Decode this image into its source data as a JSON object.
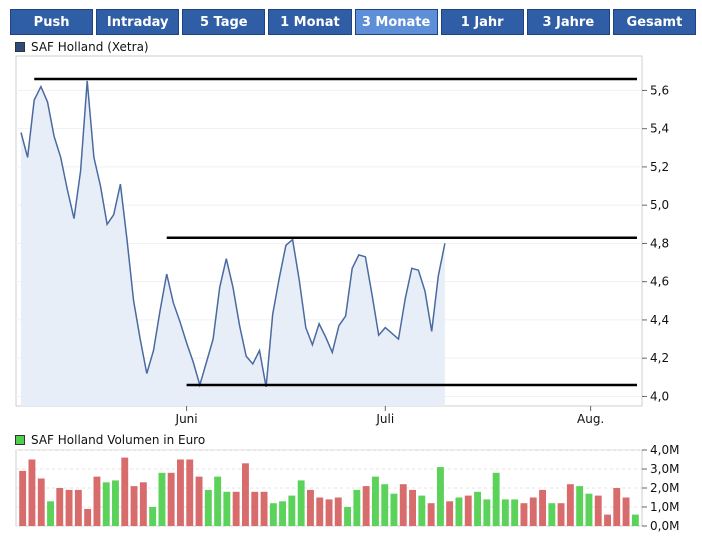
{
  "tabs": [
    {
      "label": "Push",
      "active": false
    },
    {
      "label": "Intraday",
      "active": false
    },
    {
      "label": "5 Tage",
      "active": false
    },
    {
      "label": "1 Monat",
      "active": false
    },
    {
      "label": "3 Monate",
      "active": true
    },
    {
      "label": "1 Jahr",
      "active": false
    },
    {
      "label": "3 Jahre",
      "active": false
    },
    {
      "label": "Gesamt",
      "active": false
    }
  ],
  "chart_data": [
    {
      "type": "area",
      "title": "SAF Holland (Xetra)",
      "legend_color": "#2e4a7d",
      "line_color": "#4a6aa0",
      "fill_color": "#e8eef8",
      "ylim": [
        3.95,
        5.78
      ],
      "y_ticks": [
        "5,6",
        "5,4",
        "5,2",
        "5,0",
        "4,8",
        "4,6",
        "4,4",
        "4,2",
        "4,0"
      ],
      "x_ticks": [
        {
          "label": "Juni",
          "x": 25
        },
        {
          "label": "Juli",
          "x": 55
        },
        {
          "label": "Aug.",
          "x": 86
        }
      ],
      "x_domain": [
        0,
        93
      ],
      "values": [
        5.38,
        5.25,
        5.55,
        5.62,
        5.54,
        5.36,
        5.25,
        5.08,
        4.93,
        5.18,
        5.65,
        5.25,
        5.1,
        4.9,
        4.95,
        5.11,
        4.82,
        4.5,
        4.3,
        4.12,
        4.24,
        4.45,
        4.64,
        4.49,
        4.39,
        4.28,
        4.18,
        4.06,
        4.18,
        4.3,
        4.57,
        4.72,
        4.57,
        4.37,
        4.21,
        4.17,
        4.24,
        4.05,
        4.43,
        4.62,
        4.79,
        4.82,
        4.61,
        4.36,
        4.27,
        4.38,
        4.31,
        4.23,
        4.37,
        4.42,
        4.67,
        4.74,
        4.73,
        4.53,
        4.32,
        4.36,
        4.33,
        4.3,
        4.51,
        4.67,
        4.66,
        4.55,
        4.34,
        4.63,
        4.8
      ],
      "resistance_lines": [
        5.66,
        4.83,
        4.06
      ]
    },
    {
      "type": "bar",
      "title": "SAF Holland Volumen in Euro",
      "legend_color": "#4ecf4e",
      "up_color": "#5bd35b",
      "down_color": "#d86b6b",
      "ylim": [
        0,
        4.0
      ],
      "y_ticks": [
        "4,0M",
        "3,0M",
        "2,0M",
        "1,0M",
        "0,0M"
      ],
      "values": [
        2.9,
        3.5,
        2.5,
        1.3,
        2.0,
        1.9,
        1.9,
        0.9,
        2.6,
        2.3,
        2.4,
        3.6,
        2.1,
        2.3,
        1.0,
        2.8,
        2.8,
        3.5,
        3.5,
        2.6,
        1.9,
        2.6,
        1.8,
        1.8,
        3.3,
        1.8,
        1.8,
        1.2,
        1.3,
        1.6,
        2.4,
        1.9,
        1.5,
        1.4,
        1.5,
        1.0,
        1.9,
        2.1,
        2.6,
        2.2,
        1.7,
        2.2,
        1.9,
        1.6,
        1.2,
        3.1,
        1.3,
        1.5,
        1.6,
        1.8,
        1.4,
        2.8,
        1.4,
        1.4,
        1.2,
        1.5,
        1.9,
        1.2,
        1.2,
        2.2,
        2.1,
        1.7,
        1.6,
        0.6,
        2.0,
        1.5,
        0.6
      ],
      "up": [
        0,
        0,
        0,
        1,
        0,
        0,
        0,
        0,
        0,
        1,
        1,
        0,
        0,
        0,
        1,
        1,
        0,
        0,
        0,
        0,
        1,
        1,
        1,
        0,
        0,
        0,
        0,
        1,
        1,
        1,
        1,
        0,
        0,
        0,
        0,
        1,
        1,
        0,
        1,
        1,
        1,
        0,
        0,
        1,
        0,
        1,
        0,
        1,
        0,
        1,
        1,
        1,
        1,
        1,
        0,
        0,
        0,
        1,
        0,
        0,
        1,
        1,
        0,
        0,
        0,
        0,
        1
      ]
    }
  ]
}
